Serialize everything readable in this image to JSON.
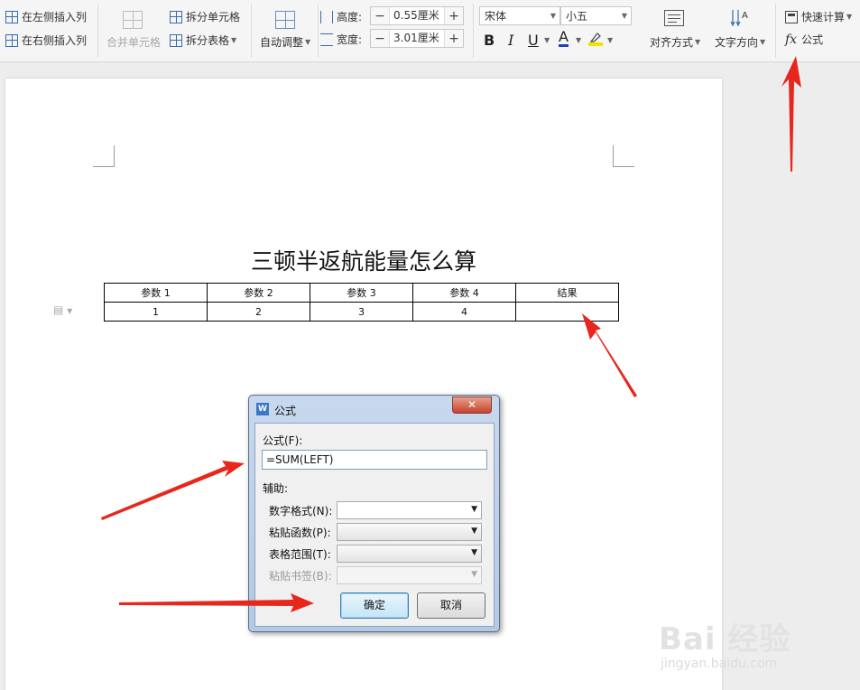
{
  "ribbon": {
    "insert_left_col": "在左侧插入列",
    "insert_right_col": "在右侧插入列",
    "merge_cells": "合并单元格",
    "split_cells": "拆分单元格",
    "split_table": "拆分表格",
    "autofit": "自动调整",
    "height_label": "高度:",
    "height_value": "0.55厘米",
    "width_label": "宽度:",
    "width_value": "3.01厘米",
    "font_name": "宋体",
    "font_size": "小五",
    "bold": "B",
    "italic": "I",
    "underline": "U",
    "font_color": "A",
    "align": "对齐方式",
    "text_direction": "文字方向",
    "quick_calc": "快速计算",
    "fx_symbol": "fx",
    "formula": "公式",
    "minus": "−",
    "plus": "+"
  },
  "document": {
    "title": "三顿半返航能量怎么算",
    "table": {
      "headers": [
        "参数 1",
        "参数 2",
        "参数 3",
        "参数 4",
        "结果"
      ],
      "rows": [
        [
          "1",
          "2",
          "3",
          "4",
          ""
        ]
      ]
    }
  },
  "dialog": {
    "title": "公式",
    "close": "✕",
    "formula_label": "公式(F):",
    "formula_value": "=SUM(LEFT)",
    "aux_label": "辅助:",
    "number_format_label": "数字格式(N):",
    "paste_function_label": "粘贴函数(P):",
    "table_range_label": "表格范围(T):",
    "paste_bookmark_label": "粘贴书签(B):",
    "ok": "确定",
    "cancel": "取消"
  },
  "watermark": {
    "main": "Bai 经验",
    "sub": "jingyan.baidu.com"
  },
  "colors": {
    "arrow": "#e8261c",
    "accent": "#3f77c8"
  }
}
